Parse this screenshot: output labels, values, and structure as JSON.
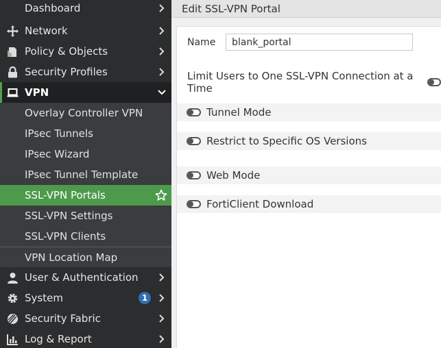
{
  "sidebar": {
    "items": [
      {
        "label": "Dashboard",
        "icon": "dashboard-icon"
      },
      {
        "label": "Network",
        "icon": "network-icon"
      },
      {
        "label": "Policy & Objects",
        "icon": "policy-icon"
      },
      {
        "label": "Security Profiles",
        "icon": "lock-icon"
      },
      {
        "label": "VPN",
        "icon": "laptop-icon"
      },
      {
        "label": "User & Authentication",
        "icon": "user-icon"
      },
      {
        "label": "System",
        "icon": "gear-icon",
        "badge": "1"
      },
      {
        "label": "Security Fabric",
        "icon": "fabric-icon"
      },
      {
        "label": "Log & Report",
        "icon": "chart-icon"
      }
    ],
    "vpn_sub": [
      "Overlay Controller VPN",
      "IPsec Tunnels",
      "IPsec Wizard",
      "IPsec Tunnel Template",
      "SSL-VPN Portals",
      "SSL-VPN Settings",
      "SSL-VPN Clients",
      "VPN Location Map"
    ]
  },
  "header": {
    "title": "Edit SSL-VPN Portal"
  },
  "form": {
    "name_label": "Name",
    "name_value": "blank_portal",
    "limit_label": "Limit Users to One SSL-VPN Connection at a Time",
    "sections": [
      "Tunnel Mode",
      "Restrict to Specific OS Versions",
      "Web Mode",
      "FortiClient Download"
    ]
  },
  "colors": {
    "sidebar_bg": "#2b2d2e",
    "active_green": "#4d9a4c",
    "badge_blue": "#2d6fb3"
  }
}
